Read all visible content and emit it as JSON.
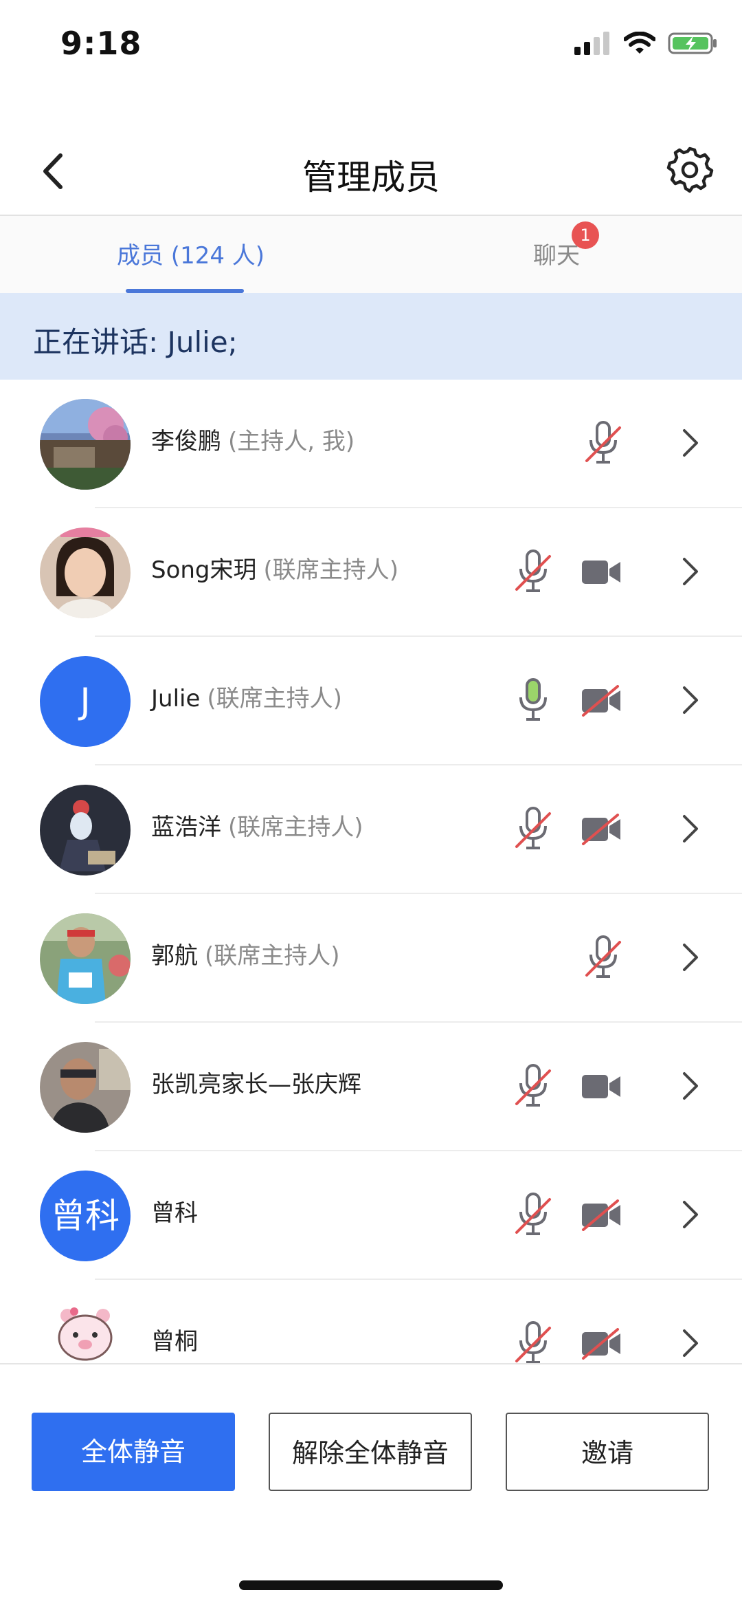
{
  "status_bar": {
    "time": "9:18",
    "icons": [
      "signal-icon",
      "wifi-icon",
      "battery-charging-icon"
    ]
  },
  "nav": {
    "title": "管理成员",
    "back_icon": "chevron-left-icon",
    "settings_icon": "gear-icon"
  },
  "tabs": {
    "members_label": "成员 (124 人)",
    "chat_label": "聊天",
    "chat_badge": "1",
    "active": "members"
  },
  "speaking": {
    "text": "正在讲话: Julie;"
  },
  "members": [
    {
      "name": "李俊鹏",
      "role": "(主持人, 我)",
      "avatar": "photo",
      "mic": "muted",
      "camera": "none"
    },
    {
      "name": "Song宋玥",
      "role": "(联席主持人)",
      "avatar": "photo",
      "mic": "muted",
      "camera": "on"
    },
    {
      "name": "Julie",
      "role": "(联席主持人)",
      "avatar": "letter",
      "avatar_text": "J",
      "mic": "speaking",
      "camera": "off"
    },
    {
      "name": "蓝浩洋",
      "role": "(联席主持人)",
      "avatar": "photo",
      "mic": "muted",
      "camera": "off"
    },
    {
      "name": "郭航",
      "role": "(联席主持人)",
      "avatar": "photo",
      "mic": "muted",
      "camera": "none"
    },
    {
      "name": "张凯亮家长—张庆辉",
      "role": "",
      "avatar": "photo",
      "mic": "muted",
      "camera": "on"
    },
    {
      "name": "曾科",
      "role": "",
      "avatar": "text",
      "avatar_text": "曾科",
      "mic": "muted",
      "camera": "off"
    },
    {
      "name": "曾桐",
      "role": "",
      "avatar": "photo",
      "mic": "muted",
      "camera": "off"
    }
  ],
  "bottom": {
    "mute_all": "全体静音",
    "unmute_all": "解除全体静音",
    "invite": "邀请"
  },
  "colors": {
    "accent": "#2f6ff0",
    "tab_active": "#4a77d9",
    "banner_bg": "#dde8f9",
    "badge": "#e85353",
    "mic_muted_slash": "#e05050",
    "mic_active": "#9bd46a",
    "icon_gray": "#6b6b73"
  }
}
